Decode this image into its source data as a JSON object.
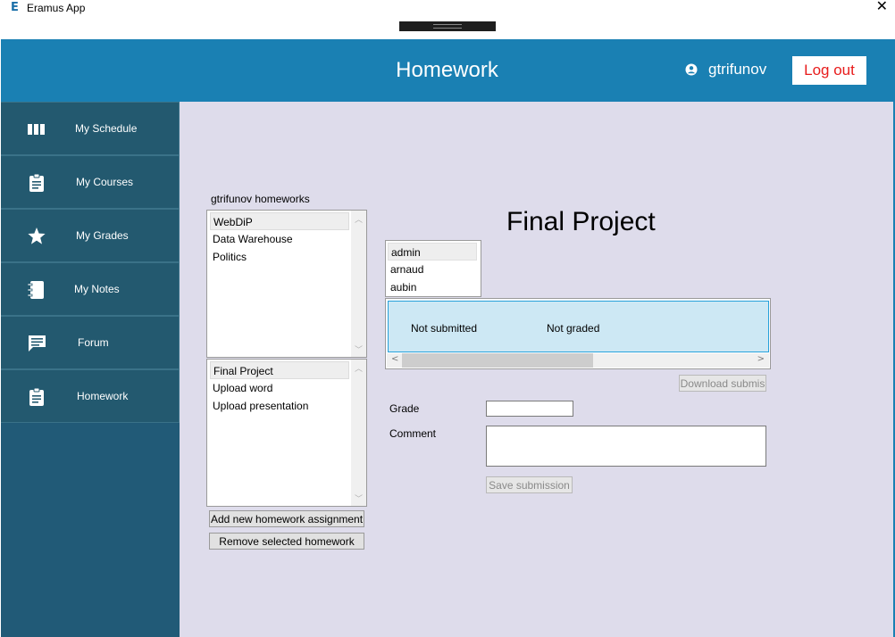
{
  "window": {
    "app_icon": "E",
    "title": "Eramus App",
    "close_glyph": "✕"
  },
  "header": {
    "title": "Homework",
    "username": "gtrifunov",
    "logout_label": "Log out"
  },
  "sidebar": {
    "items": [
      {
        "label": "My Schedule",
        "icon": "schedule-icon"
      },
      {
        "label": "My Courses",
        "icon": "clipboard-icon"
      },
      {
        "label": "My Grades",
        "icon": "star-icon"
      },
      {
        "label": "My Notes",
        "icon": "notebook-icon"
      },
      {
        "label": "Forum",
        "icon": "chat-icon"
      },
      {
        "label": "Homework",
        "icon": "clipboard-icon"
      }
    ]
  },
  "homeworks": {
    "caption": "gtrifunov homeworks",
    "courses": [
      "WebDiP",
      "Data Warehouse",
      "Politics"
    ],
    "assignments": [
      "Final Project",
      "Upload word",
      "Upload presentation"
    ],
    "add_button": "Add new homework assignment",
    "remove_button": "Remove selected homework"
  },
  "assignment": {
    "title": "Final Project",
    "students": [
      "admin",
      "arnaud",
      "aubin"
    ],
    "submission": {
      "status": "Not submitted",
      "grade": "Not graded"
    },
    "download_button": "Download submis",
    "grade_label": "Grade",
    "grade_value": "",
    "comment_label": "Comment",
    "comment_value": "",
    "save_button": "Save submission"
  },
  "colors": {
    "header_bg": "#1a80b3",
    "sidebar_bg": "#215a77",
    "content_bg": "#dedceb",
    "logout_text": "#e81c1c",
    "selected_row": "#cde8f4"
  }
}
